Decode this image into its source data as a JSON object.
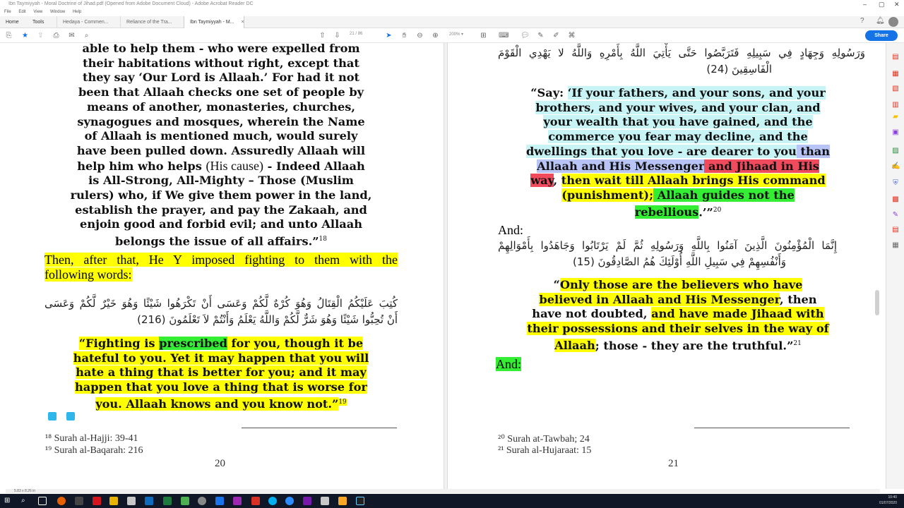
{
  "window": {
    "title": "Ibn Taymiyyah - Moral Doctrine of Jihad.pdf (Opened from Adobe Document Cloud) - Adobe Acrobat Reader DC",
    "menu": [
      "File",
      "Edit",
      "View",
      "Window",
      "Help"
    ]
  },
  "tabs": {
    "home": "Home",
    "tools": "Tools",
    "docs": [
      "Hedaya - Commen...",
      "Reliance of the Tra...",
      "Ibn Taymiyyah - M..."
    ],
    "close": "×"
  },
  "toolbar": {
    "page_current": "21",
    "page_total": "/ 86",
    "zoom": "200%",
    "share_label": "Share"
  },
  "left_page": {
    "para1_l1": "able to help them - who were expelled from",
    "para1_l2": "their habitations without right, except that",
    "para1_l3": "they say ‘Our Lord is Allaah.’ For had it not",
    "para1_l4": "been that Allaah checks one set of people by",
    "para1_l5": "means of another, monasteries, churches,",
    "para1_l6": "synagogues and mosques, wherein the Name",
    "para1_l7": "of Allaah is mentioned much, would surely",
    "para1_l8": "have been pulled down. Assuredly Allaah will",
    "para1_l9a": "help him who helps ",
    "para1_l9b": "(His cause)",
    "para1_l9c": " - Indeed Allaah",
    "para1_l10": "is All-Strong, All-Mighty – Those (Muslim",
    "para1_l11": "rulers) who, if We give them power in the land,",
    "para1_l12": "establish the prayer, and pay the Zakaah, and",
    "para1_l13": "enjoin good and forbid evil; and unto Allaah",
    "para1_l14": "belongs the issue of all affairs.”",
    "para1_fn": "18",
    "then1": "Then, after that, He Y imposed fighting to them with the",
    "then2": "following words:",
    "arabic1": "كُتِبَ عَلَيْكُمُ الْقِتَالُ وَهُوَ كُرْهٌ لَّكُمْ وَعَسَى أَنْ تَكْرَهُوا شَيْئًا وَهُوَ خَيْرٌ لَّكُمْ وَعَسَى",
    "arabic2": "أَنْ تُحِبُّوا شَيْئًا وَهُوَ شَرٌّ لَّكُمْ وَاللَّهُ يَعْلَمُ وَأَنْتُمْ لاَ تَعْلَمُونَ (216)",
    "q2_a": "“Fighting is ",
    "q2_b": "prescribed",
    "q2_c": " for you, though it be",
    "q2_l2": "hateful to you. Yet it may happen that you will",
    "q2_l3": "hate a thing that is better for you; and it may",
    "q2_l4": "happen that you love a thing that is worse for",
    "q2_l5": "you. Allaah knows and you know not.”",
    "q2_fn": "19",
    "footnote1": "¹⁸ Surah al-Hajji: 39-41",
    "footnote2": "¹⁹ Surah al-Baqarah: 216",
    "page_number": "20"
  },
  "right_page": {
    "arabic_top1": "وَرَسُولِهِ وَجِهَادٍ فِي سَبِيلِهِ فَتَرَبَّصُوا حَتَّى يَأْتِيَ اللَّهُ بِأَمْرِهِ وَاللَّهُ لا يَهْدِي الْقَوْمَ",
    "arabic_top2": "الْفَاسِقِينَ (24)",
    "say_l1a": "“Say: ",
    "say_l1b": "‘If your fathers, and your sons, and your",
    "say_l2": "brothers, and your wives, and your clan, and",
    "say_l3": "your wealth that you have gained, and the",
    "say_l4": "commerce you fear may decline, and the",
    "say_l5a": "dwellings that you love - are dearer to you",
    "say_l5b": " than",
    "say_l6a": "Allaah and His Messenger",
    "say_l6b": " and Jihaad in His",
    "say_l7a": "way",
    "say_l7b": ", ",
    "say_l7c": "then wait till Allaah brings His command",
    "say_l8a": "(punishment);",
    "say_l8b": " Allaah guides not the",
    "say_l9a": "rebellious",
    "say_l9b": ".’”",
    "say_fn": "20",
    "and1": "And:",
    "arabic_mid1": "إِنَّمَا الْمُؤْمِنُونَ الَّذِينَ آمَنُوا بِاللَّهِ وَرَسُولِهِ ثُمَّ لَمْ يَرْتَابُوا وَجَاهَدُوا بِأَمْوَالِهِمْ",
    "arabic_mid2": "وَأَنْفُسِهِمْ فِي سَبِيلِ اللَّهِ أُوْلَئِكَ هُمُ الصَّادِقُونَ (15)",
    "only_l1a": "“",
    "only_l1b": "Only those are the believers who have",
    "only_l2a": "believed in Allaah and His Messenger",
    "only_l2b": ", then",
    "only_l3a": "have not doubted, ",
    "only_l3b": "and have made Jihaad with",
    "only_l4": "their possessions and their selves in the way of",
    "only_l5a": "Allaah",
    "only_l5b": "; those - they are the truthful.”",
    "only_fn": "21",
    "and2": "And:",
    "footnote1": "²⁰ Surah at-Tawbah; 24",
    "footnote2": "²¹ Surah al-Hujaraat: 15",
    "page_number": "21"
  },
  "status": {
    "page_size": "5.83 x 8.26 in"
  },
  "taskbar": {
    "time": "10:40",
    "date": "01/07/2020"
  },
  "colors": {
    "highlight_yellow": "#ffff00",
    "highlight_green": "#33ee33",
    "highlight_cyan": "#c9f4f6",
    "highlight_blue": "#b9c4f6",
    "highlight_red": "#f04a5d",
    "accent": "#1473e6"
  }
}
